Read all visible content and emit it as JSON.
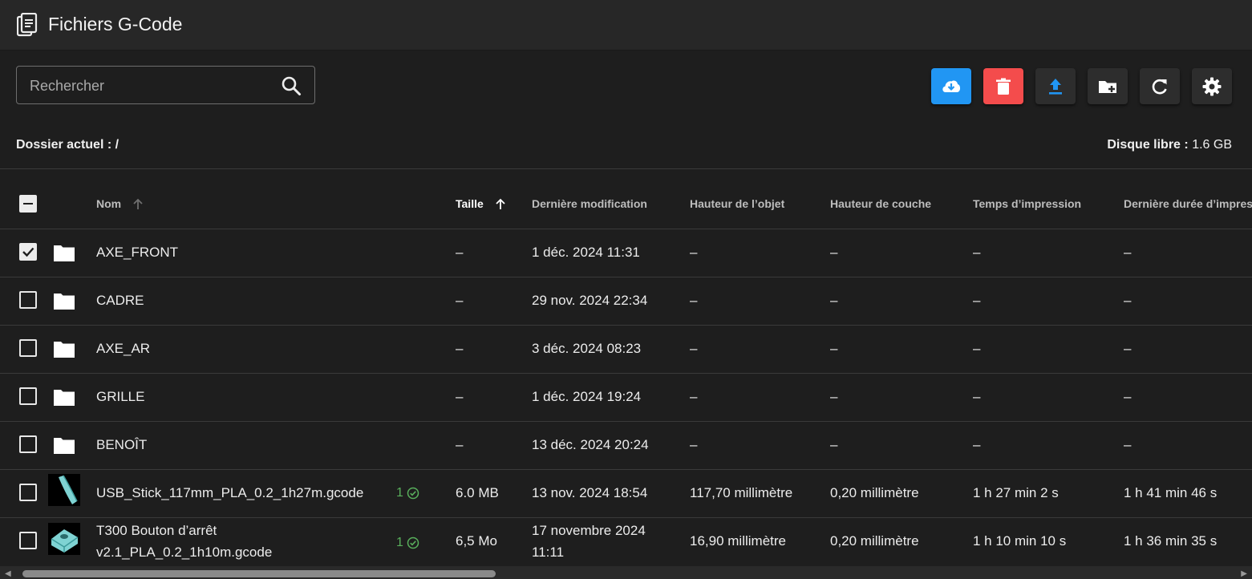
{
  "header": {
    "title": "Fichiers G-Code",
    "icon": "file-document-icon"
  },
  "search": {
    "placeholder": "Rechercher",
    "value": ""
  },
  "toolbar": {
    "buttons": [
      {
        "name": "cloud-download",
        "color": "#2196f3"
      },
      {
        "name": "delete",
        "color": "#f44c4c"
      },
      {
        "name": "upload",
        "color": "#2d2d2d"
      },
      {
        "name": "new-folder",
        "color": "#2d2d2d"
      },
      {
        "name": "refresh",
        "color": "#2d2d2d"
      },
      {
        "name": "settings",
        "color": "#2d2d2d"
      }
    ]
  },
  "info": {
    "current_folder_label": "Dossier actuel :",
    "current_folder_value": "/",
    "disk_free_label": "Disque libre :",
    "disk_free_value": "1.6 GB"
  },
  "table": {
    "columns": {
      "name": "Nom",
      "size": "Taille",
      "modified": "Dernière modification",
      "object_height": "Hauteur de l’objet",
      "layer_height": "Hauteur de couche",
      "print_time": "Temps d’impression",
      "last_duration": "Dernière durée d’impres"
    },
    "rows": [
      {
        "type": "folder",
        "checked": true,
        "name": "AXE_FRONT",
        "size": "–",
        "modified": "1 déc. 2024 11:31",
        "object_height": "–",
        "layer_height": "–",
        "print_time": "–",
        "last_duration": "–"
      },
      {
        "type": "folder",
        "checked": false,
        "name": "CADRE",
        "size": "–",
        "modified": "29 nov. 2024 22:34",
        "object_height": "–",
        "layer_height": "–",
        "print_time": "–",
        "last_duration": "–"
      },
      {
        "type": "folder",
        "checked": false,
        "name": "AXE_AR",
        "size": "–",
        "modified": "3 déc. 2024 08:23",
        "object_height": "–",
        "layer_height": "–",
        "print_time": "–",
        "last_duration": "–"
      },
      {
        "type": "folder",
        "checked": false,
        "name": "GRILLE",
        "size": "–",
        "modified": "1 déc. 2024 19:24",
        "object_height": "–",
        "layer_height": "–",
        "print_time": "–",
        "last_duration": "–"
      },
      {
        "type": "folder",
        "checked": false,
        "name": "BENOÎT",
        "size": "–",
        "modified": "13 déc. 2024 20:24",
        "object_height": "–",
        "layer_height": "–",
        "print_time": "–",
        "last_duration": "–"
      },
      {
        "type": "file",
        "checked": false,
        "name": "USB_Stick_117mm_PLA_0.2_1h27m.gcode",
        "print_count": "1",
        "size": "6.0 MB",
        "modified": "13 nov. 2024 18:54",
        "object_height": "117,70 millimètre",
        "layer_height": "0,20 millimètre",
        "print_time": "1 h 27 min 2 s",
        "last_duration": "1 h 41 min 46 s"
      },
      {
        "type": "file",
        "checked": false,
        "name_line1": "T300 Bouton d’arrêt",
        "name_line2": "v2.1_PLA_0.2_1h10m.gcode",
        "print_count": "1",
        "size": "6,5 Mo",
        "modified_line1": "17 novembre 2024",
        "modified_line2": "11:11",
        "object_height": "16,90 millimètre",
        "layer_height": "0,20 millimètre",
        "print_time": "1 h 10 min 10 s",
        "last_duration": "1 h 36 min 35 s"
      }
    ]
  }
}
